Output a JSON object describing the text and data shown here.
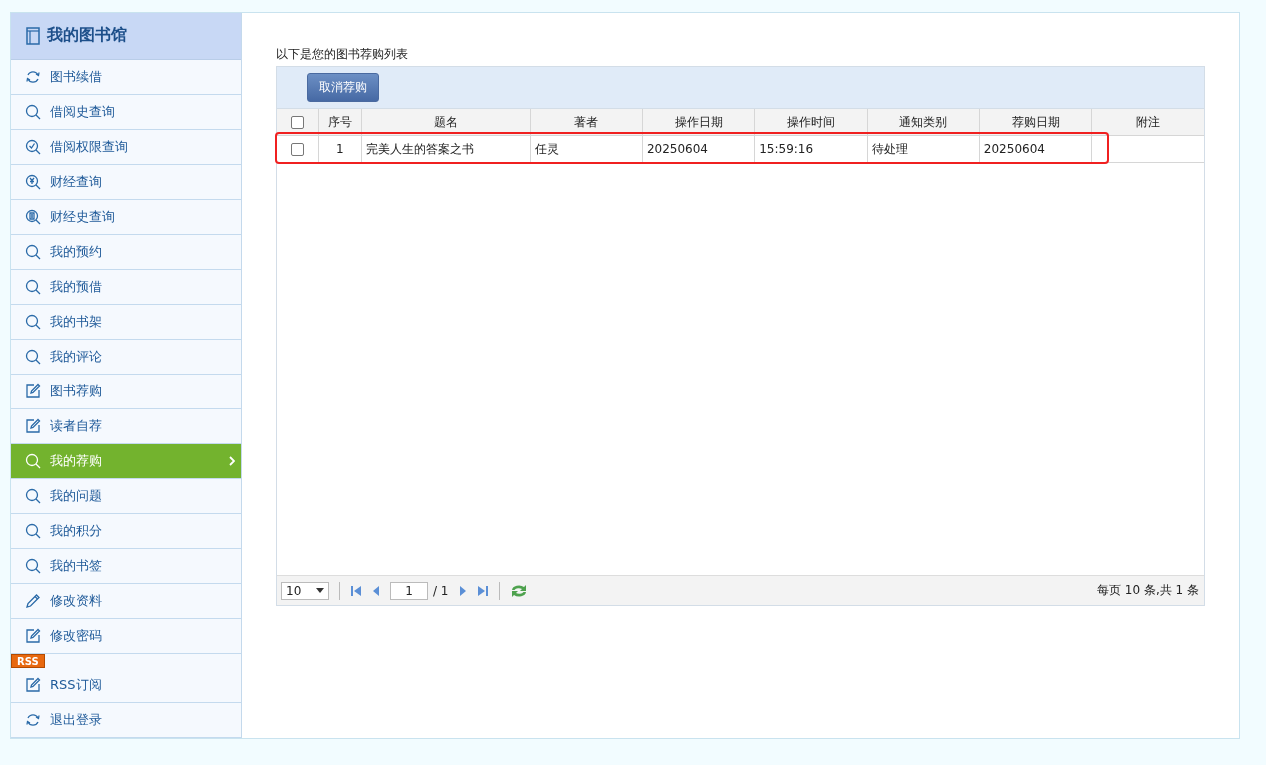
{
  "sidebar": {
    "title": "我的图书馆",
    "items": [
      {
        "label": "图书续借",
        "kind": "refresh",
        "selected": false
      },
      {
        "label": "借阅史查询",
        "kind": "search",
        "selected": false
      },
      {
        "label": "借阅权限查询",
        "kind": "search-check",
        "selected": false
      },
      {
        "label": "财经查询",
        "kind": "search-yen",
        "selected": false
      },
      {
        "label": "财经史查询",
        "kind": "search-doc",
        "selected": false
      },
      {
        "label": "我的预约",
        "kind": "search",
        "selected": false
      },
      {
        "label": "我的预借",
        "kind": "search",
        "selected": false
      },
      {
        "label": "我的书架",
        "kind": "search",
        "selected": false
      },
      {
        "label": "我的评论",
        "kind": "search",
        "selected": false
      },
      {
        "label": "图书荐购",
        "kind": "edit",
        "selected": false
      },
      {
        "label": "读者自荐",
        "kind": "edit",
        "selected": false
      },
      {
        "label": "我的荐购",
        "kind": "search",
        "selected": true
      },
      {
        "label": "我的问题",
        "kind": "search",
        "selected": false
      },
      {
        "label": "我的积分",
        "kind": "search",
        "selected": false
      },
      {
        "label": "我的书签",
        "kind": "search",
        "selected": false
      },
      {
        "label": "修改资料",
        "kind": "pencil",
        "selected": false
      },
      {
        "label": "修改密码",
        "kind": "edit",
        "selected": false
      },
      {
        "label": "RSS订阅",
        "kind": "edit",
        "selected": false,
        "badge": "RSS"
      },
      {
        "label": "退出登录",
        "kind": "refresh",
        "selected": false
      }
    ]
  },
  "main": {
    "caption": "以下是您的图书荐购列表",
    "toolbar_button": "取消荐购",
    "table": {
      "select_all_checked": false,
      "columns": [
        {
          "label": "序号",
          "kind": "index"
        },
        {
          "label": "题名",
          "kind": "text"
        },
        {
          "label": "著者",
          "kind": "text"
        },
        {
          "label": "操作日期",
          "kind": "text"
        },
        {
          "label": "操作时间",
          "kind": "text"
        },
        {
          "label": "通知类别",
          "kind": "text"
        },
        {
          "label": "荐购日期",
          "kind": "text"
        },
        {
          "label": "附注",
          "kind": "text"
        }
      ],
      "rows": [
        {
          "checked": false,
          "highlighted": true,
          "cells": [
            "1",
            "完美人生的答案之书",
            "任灵",
            "20250604",
            "15:59:16",
            "待处理",
            "20250604",
            ""
          ]
        }
      ]
    },
    "pager": {
      "page_size": "10",
      "page": "1",
      "total_pages": "/ 1",
      "summary": "每页 10 条,共 1 条"
    }
  }
}
